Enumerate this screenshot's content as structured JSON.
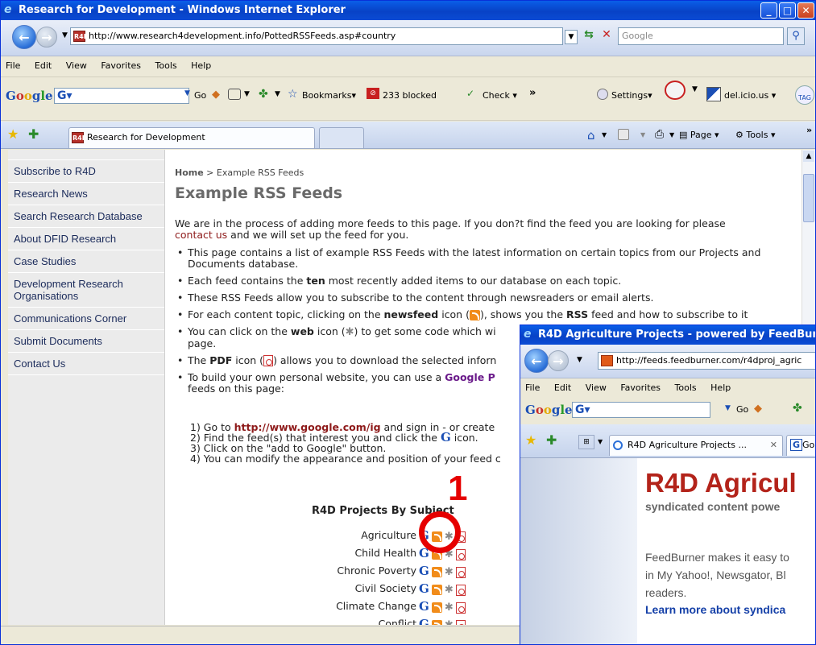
{
  "window": {
    "title": "Research for Development - Windows Internet Explorer",
    "url": "http://www.research4development.info/PottedRSSFeeds.asp#country",
    "search_placeholder": "Google"
  },
  "menubar": [
    "File",
    "Edit",
    "View",
    "Favorites",
    "Tools",
    "Help"
  ],
  "google_toolbar": {
    "go": "Go",
    "bookmarks": "Bookmarks",
    "blocked": "233 blocked",
    "check": "Check",
    "more": "»",
    "settings": "Settings",
    "delicious": "del.icio.us",
    "tag": "TAG"
  },
  "tabbar": {
    "tab_title": "Research for Development",
    "page": "Page",
    "tools": "Tools"
  },
  "sidebar": {
    "items": [
      {
        "label": "Subscribe to R4D"
      },
      {
        "label": "Research News"
      },
      {
        "label": "Search Research Database"
      },
      {
        "label": "About DFID Research"
      },
      {
        "label": "Case Studies"
      },
      {
        "label": "Development Research Organisations"
      },
      {
        "label": "Communications Corner"
      },
      {
        "label": "Submit Documents"
      },
      {
        "label": "Contact Us"
      }
    ]
  },
  "main": {
    "breadcrumb_home": "Home",
    "breadcrumb_sep": " > ",
    "breadcrumb_current": "Example RSS Feeds",
    "heading": "Example RSS Feeds",
    "intro_before": "We are in the process of adding more feeds to this page. If you don?t find the feed you are looking for please",
    "intro_link": "contact us",
    "intro_after": " and we will set up the feed for you.",
    "bullets": {
      "b1": "This page contains a list of example RSS Feeds with the latest information on certain topics from our Projects and Documents database.",
      "b2_pre": "Each feed contains the ",
      "b2_bold": "ten",
      "b2_post": " most recently added items to our database on each topic.",
      "b3": "These RSS Feeds allow you to subscribe to the content through newsreaders or email alerts.",
      "b4_pre": "For each content topic, clicking on the ",
      "b4_bold": "newsfeed",
      "b4_post": " icon (",
      "b4_tail": "), shows you the ",
      "b4_bold2": "RSS",
      "b4_end": " feed and how to subscribe to it",
      "b5_pre": "You can click on the ",
      "b5_bold": "web",
      "b5_post": " icon (",
      "b5_tail": ") to get some code which wi",
      "b5_line2": "page.",
      "b6_pre": "The ",
      "b6_bold": "PDF",
      "b6_post": " icon (",
      "b6_tail": ") allows you to download the selected inforn",
      "b7_pre": "To build your own personal website, you can use a ",
      "b7_bold": "Google P",
      "b7_line2": "feeds on this page:"
    },
    "steps": {
      "s1_pre": "1) Go to ",
      "s1_link": "http://www.google.com/ig",
      "s1_post": " and sign in - or create",
      "s2_pre": "2) Find the feed(s) that interest you and click the ",
      "s2_g": "G",
      "s2_post": " icon.",
      "s3": "3) Click on the \"add to Google\" button.",
      "s4": "4) You can modify the appearance and position of your feed c"
    },
    "projects_title": "R4D Projects By Subject",
    "subjects": [
      "Agriculture",
      "Child Health",
      "Chronic Poverty",
      "Civil Society",
      "Climate Change",
      "Conflict"
    ],
    "g_icon": "G"
  },
  "annotation": {
    "number": "1",
    "color": "#e60000"
  },
  "popup": {
    "title": "R4D Agriculture Projects - powered by FeedBur",
    "url": "http://feeds.feedburner.com/r4dproj_agric",
    "menubar": [
      "File",
      "Edit",
      "View",
      "Favorites",
      "Tools",
      "Help"
    ],
    "go": "Go",
    "tab_title": "R4D Agriculture Projects ...",
    "tab2": "Go",
    "page_title": "R4D Agricul",
    "page_subtitle": "syndicated content powe",
    "body_line1": "FeedBurner makes it easy to",
    "body_line2": "in My Yahoo!, Newsgator, Bl",
    "body_line3": "readers.",
    "learn_more": "Learn more about syndica"
  },
  "colors": {
    "title_bar": "#0842c6",
    "accent_link": "#8e1a1a",
    "popup_title": "#b3231a"
  }
}
